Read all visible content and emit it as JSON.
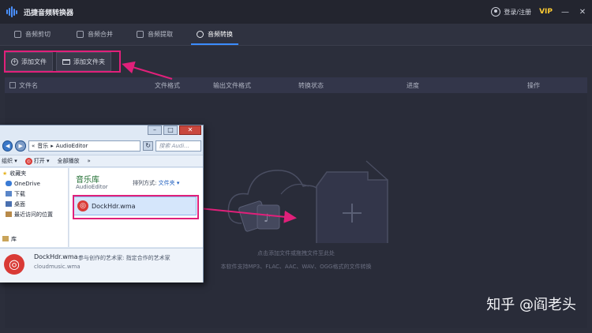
{
  "titlebar": {
    "app_title": "迅捷音频转换器",
    "login": "登录/注册",
    "vip": "VIP",
    "minimize": "—",
    "close": "✕"
  },
  "tabs": [
    {
      "label": "音频剪切"
    },
    {
      "label": "音频合并"
    },
    {
      "label": "音频提取"
    },
    {
      "label": "音频转换",
      "active": true
    }
  ],
  "toolbar": {
    "add_file": "添加文件",
    "add_folder": "添加文件夹"
  },
  "table_header": {
    "file_name": "文件名",
    "file_format": "文件格式",
    "output_format": "输出文件格式",
    "status": "转换状态",
    "progress": "进度",
    "actions": "操作"
  },
  "dropzone": {
    "hint": "点击添加文件或拖拽文件至此处",
    "supported": "本软件支持MP3、FLAC、AAC、WAV、OGG格式的文件转换"
  },
  "watermark": "知乎 @阎老头",
  "explorer": {
    "breadcrumb": [
      "«",
      "音乐",
      "▸",
      "AudioEditor"
    ],
    "search_placeholder": "搜索 Audi...",
    "cmd": {
      "organize": "组织 ▾",
      "open": "打开 ▾",
      "play_all": "全部播放",
      "more": "»"
    },
    "sidebar": [
      {
        "label": "收藏夹",
        "icon": "star-icon"
      },
      {
        "label": "OneDrive",
        "icon": "cloud-icon"
      },
      {
        "label": "下载",
        "icon": "download-folder-icon"
      },
      {
        "label": "桌面",
        "icon": "desktop-icon"
      },
      {
        "label": "最近访问的位置",
        "icon": "recent-icon"
      },
      {
        "label": "库",
        "icon": "library-icon"
      }
    ],
    "library_title": "音乐库",
    "library_sub": "AudioEditor",
    "arrange_label": "排列方式:",
    "arrange_value": "文件夹 ▾",
    "file_name": "DockHdr.wma",
    "details": {
      "name": "DockHdr.wma",
      "meta": "参与创作的艺术家: 指定合作的艺术家",
      "source": "cloudmusic.wma"
    }
  },
  "colors": {
    "highlight": "#e0207a",
    "accent": "#3b8cff",
    "vip": "#ffcc33"
  }
}
